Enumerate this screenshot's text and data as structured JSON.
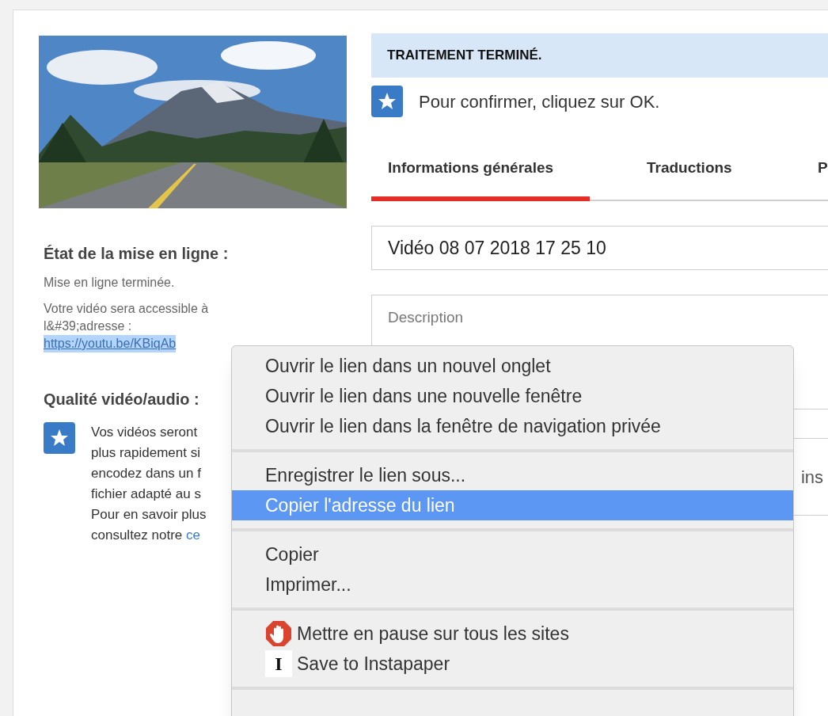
{
  "upload": {
    "heading": "État de la mise en ligne :",
    "status": "Mise en ligne terminée.",
    "note_lines": [
      "Votre vidéo sera accessible à",
      "l&#39;adresse :"
    ],
    "link": "https://youtu.be/KBiqAb"
  },
  "quality": {
    "heading": "Qualité vidéo/audio :",
    "lines": [
      {
        "text": "Vos vidéos seront"
      },
      {
        "text": "plus rapidement si"
      },
      {
        "text": "encodez dans un f"
      },
      {
        "text": "fichier adapté au s"
      },
      {
        "text": "Pour en savoir plus"
      },
      {
        "text": "consultez notre ",
        "link": "ce"
      }
    ]
  },
  "banner": {
    "title": "TRAITEMENT TERMINÉ.",
    "message": "Pour confirmer, cliquez sur OK."
  },
  "tabs": [
    {
      "label": "Informations générales",
      "selected": true
    },
    {
      "label": "Traductions",
      "selected": false
    },
    {
      "label": "P",
      "selected": false
    }
  ],
  "title_field": {
    "value": "Vidéo 08 07 2018 17 25 10"
  },
  "description_field": {
    "placeholder": "Description"
  },
  "field_fragment": "ins",
  "context_menu": {
    "groups": [
      [
        {
          "label": "Ouvrir le lien dans un nouvel onglet",
          "selected": false
        },
        {
          "label": "Ouvrir le lien dans une nouvelle fenêtre",
          "selected": false
        },
        {
          "label": "Ouvrir le lien dans la fenêtre de navigation privée",
          "selected": false
        }
      ],
      [
        {
          "label": "Enregistrer le lien sous...",
          "selected": false
        },
        {
          "label": "Copier l'adresse du lien",
          "selected": true
        }
      ],
      [
        {
          "label": "Copier",
          "selected": false
        },
        {
          "label": "Imprimer...",
          "selected": false
        }
      ],
      [
        {
          "label": "Mettre en pause sur tous les sites",
          "selected": false,
          "kind": "stop"
        },
        {
          "label": "Save to Instapaper",
          "selected": false,
          "kind": "letter",
          "glyph": "I"
        }
      ]
    ]
  }
}
